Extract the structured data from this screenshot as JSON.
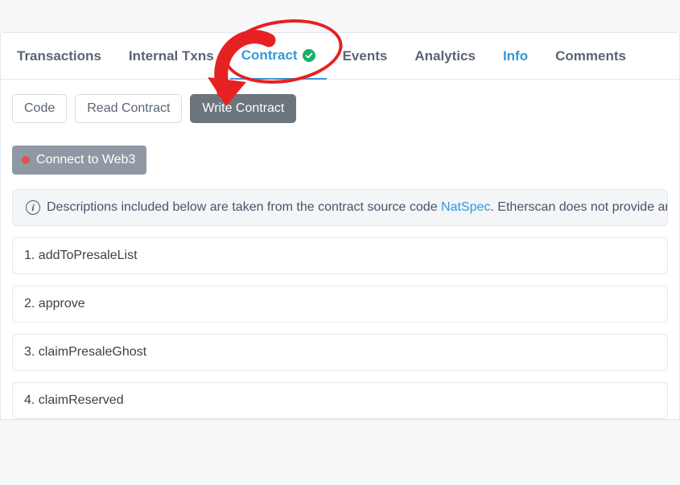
{
  "tabs": {
    "transactions": "Transactions",
    "internal_txns": "Internal Txns",
    "contract": "Contract",
    "events": "Events",
    "analytics": "Analytics",
    "info": "Info",
    "comments": "Comments"
  },
  "subtabs": {
    "code": "Code",
    "read": "Read Contract",
    "write": "Write Contract"
  },
  "connect": {
    "label": "Connect to Web3"
  },
  "notice": {
    "prefix": "Descriptions included below are taken from the contract source code ",
    "link": "NatSpec",
    "suffix": ". Etherscan does not provide any"
  },
  "functions": [
    {
      "label": "1. addToPresaleList"
    },
    {
      "label": "2. approve"
    },
    {
      "label": "3. claimPresaleGhost"
    },
    {
      "label": "4. claimReserved"
    }
  ]
}
